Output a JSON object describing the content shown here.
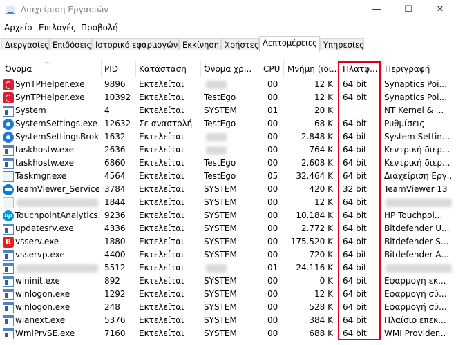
{
  "window": {
    "title": "Διαχείριση Εργασιών",
    "minimize": "—",
    "maximize": "☐",
    "close": "✕"
  },
  "menu": [
    "Αρχείο",
    "Επιλογές",
    "Προβολή"
  ],
  "tabs": [
    "Διεργασίες",
    "Επιδόσεις",
    "Ιστορικό εφαρμογών",
    "Εκκίνηση",
    "Χρήστες",
    "Λεπτομέρειες",
    "Υπηρεσίες"
  ],
  "active_tab": 5,
  "columns": [
    "Όνομα",
    "PID",
    "Κατάσταση",
    "Όνομα χρ...",
    "CPU",
    "Μνήμη (ιδι...",
    "Πλατφ...",
    "Περιγραφή"
  ],
  "rows": [
    {
      "icon": "synaptics-icon",
      "name": "SynTPHelper.exe",
      "pid": "9896",
      "status": "Εκτελείται",
      "user": "",
      "cpu": "00",
      "mem": "12 K",
      "platform": "64 bit",
      "desc": "Synaptics Poi..."
    },
    {
      "icon": "synaptics-icon",
      "name": "SynTPHelper.exe",
      "pid": "10392",
      "status": "Εκτελείται",
      "user": "TestEgo",
      "cpu": "00",
      "mem": "12 K",
      "platform": "64 bit",
      "desc": "Synaptics Poi..."
    },
    {
      "icon": "window-icon",
      "name": "System",
      "pid": "4",
      "status": "Εκτελείται",
      "user": "SYSTEM",
      "cpu": "01",
      "mem": "20 K",
      "platform": "",
      "desc": "NT Kernel & ..."
    },
    {
      "icon": "gear-icon",
      "name": "SystemSettings.exe",
      "pid": "12632",
      "status": "Σε αναστολή",
      "user": "TestEgo",
      "cpu": "00",
      "mem": "68 K",
      "platform": "64 bit",
      "desc": "Ρυθμίσεις"
    },
    {
      "icon": "gear-icon",
      "name": "SystemSettingsBroke...",
      "pid": "1632",
      "status": "Εκτελείται",
      "user": "",
      "cpu": "00",
      "mem": "2.848 K",
      "platform": "64 bit",
      "desc": "System Settin..."
    },
    {
      "icon": "window-icon",
      "name": "taskhostw.exe",
      "pid": "2636",
      "status": "Εκτελείται",
      "user": "",
      "cpu": "00",
      "mem": "764 K",
      "platform": "64 bit",
      "desc": "Κεντρική διερ..."
    },
    {
      "icon": "window-icon",
      "name": "taskhostw.exe",
      "pid": "6860",
      "status": "Εκτελείται",
      "user": "TestEgo",
      "cpu": "00",
      "mem": "2.608 K",
      "platform": "64 bit",
      "desc": "Κεντρική διερ..."
    },
    {
      "icon": "task-manager-icon",
      "name": "Taskmgr.exe",
      "pid": "4564",
      "status": "Εκτελείται",
      "user": "TestEgo",
      "cpu": "05",
      "mem": "32.464 K",
      "platform": "64 bit",
      "desc": "Διαχείριση Εργ..."
    },
    {
      "icon": "teamviewer-icon",
      "name": "TeamViewer_Service.",
      "pid": "3784",
      "status": "Εκτελείται",
      "user": "SYSTEM",
      "cpu": "00",
      "mem": "420 K",
      "platform": "32 bit",
      "desc": "TeamViewer 13"
    },
    {
      "icon": "blank-icon",
      "name": "",
      "pid": "1844",
      "status": "Εκτελείται",
      "user": "SYSTEM",
      "cpu": "00",
      "mem": "12 K",
      "platform": "64 bit",
      "desc": ""
    },
    {
      "icon": "hp-icon",
      "name": "TouchpointAnalytics...",
      "pid": "9236",
      "status": "Εκτελείται",
      "user": "SYSTEM",
      "cpu": "00",
      "mem": "10.184 K",
      "platform": "64 bit",
      "desc": "HP Touchpoi..."
    },
    {
      "icon": "window-icon",
      "name": "updatesrv.exe",
      "pid": "4336",
      "status": "Εκτελείται",
      "user": "SYSTEM",
      "cpu": "00",
      "mem": "2.772 K",
      "platform": "64 bit",
      "desc": "Bitdefender U..."
    },
    {
      "icon": "bitdefender-icon",
      "name": "vsserv.exe",
      "pid": "1880",
      "status": "Εκτελείται",
      "user": "SYSTEM",
      "cpu": "00",
      "mem": "175.520 K",
      "platform": "64 bit",
      "desc": "Bitdefender S..."
    },
    {
      "icon": "window-icon",
      "name": "vsservp.exe",
      "pid": "4400",
      "status": "Εκτελείται",
      "user": "SYSTEM",
      "cpu": "00",
      "mem": "720 K",
      "platform": "64 bit",
      "desc": "Bitdefender A..."
    },
    {
      "icon": "window-icon",
      "name": "",
      "pid": "5512",
      "status": "Εκτελείται",
      "user": "",
      "cpu": "01",
      "mem": "24.116 K",
      "platform": "64 bit",
      "desc": ""
    },
    {
      "icon": "window-icon",
      "name": "wininit.exe",
      "pid": "892",
      "status": "Εκτελείται",
      "user": "SYSTEM",
      "cpu": "00",
      "mem": "0 K",
      "platform": "64 bit",
      "desc": "Εφαρμογή εκ..."
    },
    {
      "icon": "window-icon",
      "name": "winlogon.exe",
      "pid": "1292",
      "status": "Εκτελείται",
      "user": "SYSTEM",
      "cpu": "00",
      "mem": "12 K",
      "platform": "64 bit",
      "desc": "Εφαρμογή σύ..."
    },
    {
      "icon": "window-icon",
      "name": "winlogon.exe",
      "pid": "248",
      "status": "Εκτελείται",
      "user": "SYSTEM",
      "cpu": "00",
      "mem": "528 K",
      "platform": "64 bit",
      "desc": "Εφαρμογή σύ..."
    },
    {
      "icon": "window-icon",
      "name": "wlanext.exe",
      "pid": "5376",
      "status": "Εκτελείται",
      "user": "SYSTEM",
      "cpu": "00",
      "mem": "384 K",
      "platform": "64 bit",
      "desc": "Πλαίσιο επεκ..."
    },
    {
      "icon": "window-icon",
      "name": "WmiPrvSE.exe",
      "pid": "7160",
      "status": "Εκτελείται",
      "user": "SYSTEM",
      "cpu": "00",
      "mem": "688 K",
      "platform": "64 bit",
      "desc": "WMI Provider..."
    }
  ]
}
